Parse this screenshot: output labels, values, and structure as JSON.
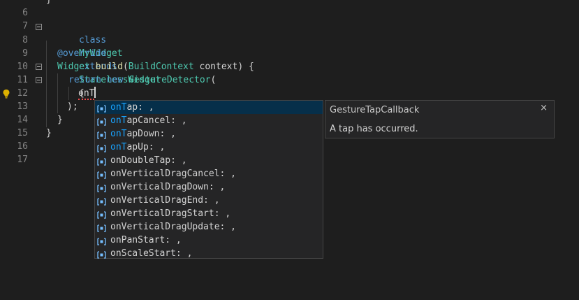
{
  "editor": {
    "lines": [
      {
        "num": "6",
        "text": "}"
      },
      {
        "num": "7",
        "text": ""
      },
      {
        "num": "8",
        "kw1": "class",
        "name": "MyWidget",
        "kw2": "extends",
        "base": "StatelessWidget",
        "brace": "{"
      },
      {
        "num": "9",
        "text": ""
      },
      {
        "num": "10",
        "annotation": "@override"
      },
      {
        "num": "11",
        "type": "Widget",
        "fn": "build",
        "open": "(",
        "ptype": "BuildContext",
        "pname": "context",
        "close": ") {"
      },
      {
        "num": "12",
        "kw1": "return",
        "kw2": "new",
        "type": "GestureDetector",
        "open": "("
      },
      {
        "num": "13",
        "typed": "onT"
      },
      {
        "num": "14",
        "text": ");"
      },
      {
        "num": "15",
        "text": "}"
      },
      {
        "num": "16",
        "text": "}"
      },
      {
        "num": "17",
        "text": ""
      }
    ]
  },
  "suggestions": {
    "selected_index": 0,
    "items": [
      {
        "match": "onT",
        "rest": "ap: ,"
      },
      {
        "match": "onT",
        "rest": "apCancel: ,"
      },
      {
        "match": "onT",
        "rest": "apDown: ,"
      },
      {
        "match": "onT",
        "rest": "apUp: ,"
      },
      {
        "label": "onDoubleTap: ,"
      },
      {
        "label": "onVerticalDragCancel: ,"
      },
      {
        "label": "onVerticalDragDown: ,"
      },
      {
        "label": "onVerticalDragEnd: ,"
      },
      {
        "label": "onVerticalDragStart: ,"
      },
      {
        "label": "onVerticalDragUpdate: ,"
      },
      {
        "label": "onPanStart: ,"
      },
      {
        "label": "onScaleStart: ,"
      }
    ]
  },
  "details": {
    "title": "GestureTapCallback",
    "description": "A tap has occurred.",
    "close_label": "×"
  },
  "colors": {
    "background": "#1e1e1e",
    "keyword": "#569cd6",
    "type": "#4ec9b0",
    "function": "#dcdcaa",
    "highlight": "#18a3ff",
    "selected": "#062f4a"
  },
  "icons": {
    "property": "field-icon",
    "lightbulb": "lightbulb-icon"
  }
}
